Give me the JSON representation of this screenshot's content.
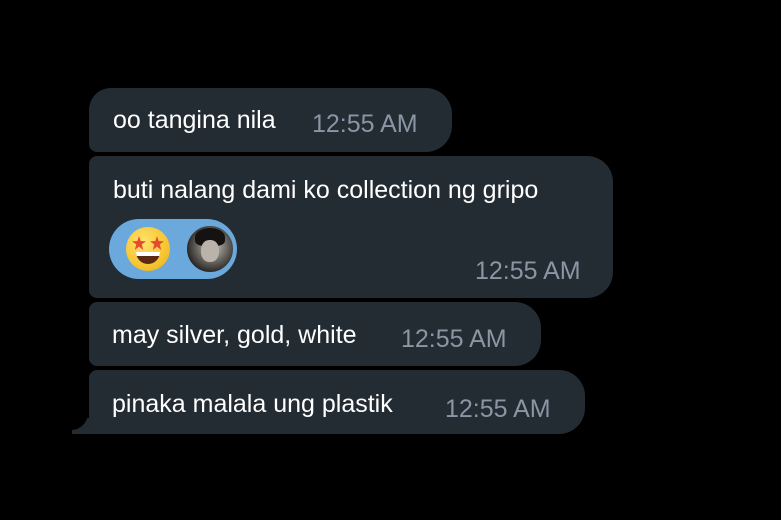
{
  "messages": [
    {
      "text": "oo tangina nila",
      "time": "12:55 AM"
    },
    {
      "text": "buti nalang dami ko collection ng gripo",
      "time": "12:55 AM"
    },
    {
      "text": "may silver, gold, white",
      "time": "12:55 AM"
    },
    {
      "text": "pinaka malala ung plastik",
      "time": "12:55 AM"
    }
  ],
  "reaction": {
    "emoji_icon": "star-struck-emoji",
    "avatar_icon": "user-avatar-photo",
    "background": "#6ba9dc"
  },
  "colors": {
    "background": "#000000",
    "bubble": "#232b33",
    "text": "#ffffff",
    "time": "#8a96a3"
  }
}
